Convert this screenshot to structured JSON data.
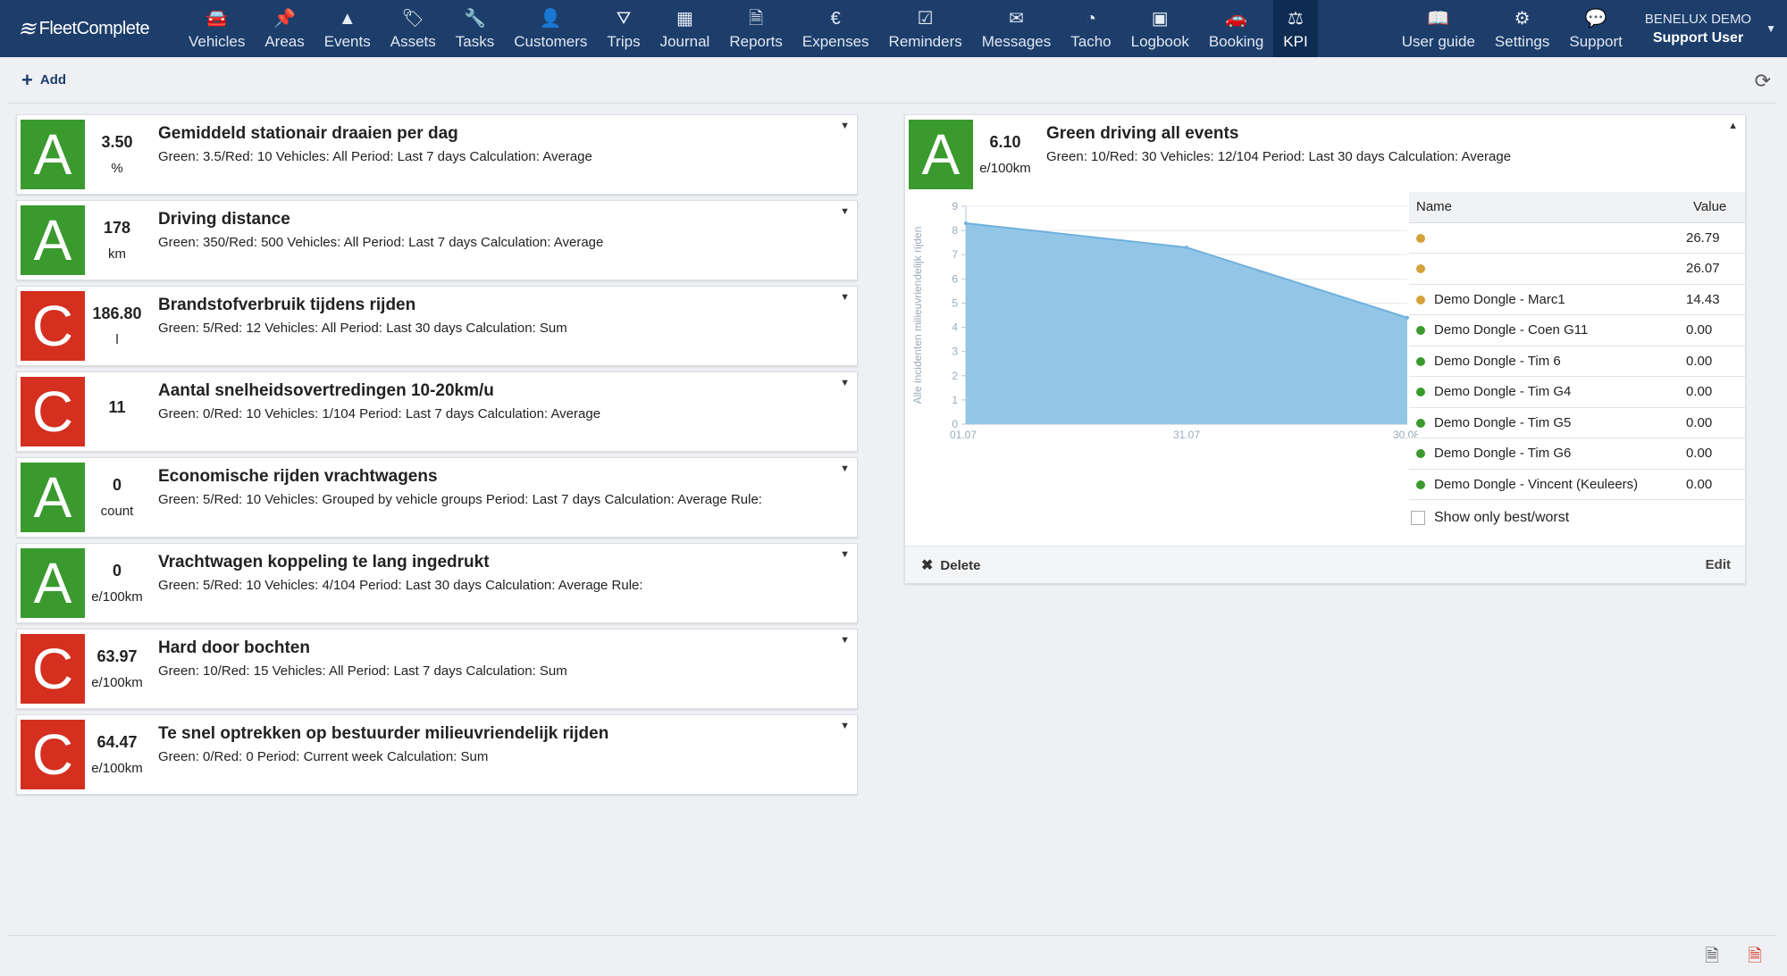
{
  "brand": {
    "name": "FleetComplete"
  },
  "nav": {
    "items": [
      {
        "label": "Vehicles",
        "icon": "car-icon"
      },
      {
        "label": "Areas",
        "icon": "pin-icon"
      },
      {
        "label": "Events",
        "icon": "warning-icon"
      },
      {
        "label": "Assets",
        "icon": "tag-icon"
      },
      {
        "label": "Tasks",
        "icon": "wrench-icon"
      },
      {
        "label": "Customers",
        "icon": "person-icon"
      },
      {
        "label": "Trips",
        "icon": "road-icon"
      },
      {
        "label": "Journal",
        "icon": "calendar-icon"
      },
      {
        "label": "Reports",
        "icon": "document-icon"
      },
      {
        "label": "Expenses",
        "icon": "euro-icon"
      },
      {
        "label": "Reminders",
        "icon": "calendar-check-icon"
      },
      {
        "label": "Messages",
        "icon": "envelope-icon"
      },
      {
        "label": "Tacho",
        "icon": "dashboard-icon"
      },
      {
        "label": "Logbook",
        "icon": "briefcase-icon"
      },
      {
        "label": "Booking",
        "icon": "car-front-icon"
      },
      {
        "label": "KPI",
        "icon": "balance-icon"
      }
    ],
    "active": "KPI",
    "right_items": [
      {
        "label": "User guide",
        "icon": "book-icon"
      },
      {
        "label": "Settings",
        "icon": "gears-icon"
      },
      {
        "label": "Support",
        "icon": "chat-icon"
      }
    ],
    "account": {
      "org": "BENELUX DEMO",
      "user": "Support User"
    }
  },
  "toolbar": {
    "add_label": "Add"
  },
  "kpis": [
    {
      "grade": "A",
      "value": "3.50",
      "unit": "%",
      "title": "Gemiddeld stationair draaien per dag",
      "desc": "Green: 3.5/Red: 10 Vehicles: All Period: Last 7 days Calculation: Average"
    },
    {
      "grade": "A",
      "value": "178",
      "unit": "km",
      "title": "Driving distance",
      "desc": "Green: 350/Red: 500 Vehicles: All Period: Last 7 days Calculation: Average"
    },
    {
      "grade": "C",
      "value": "186.80",
      "unit": "l",
      "title": "Brandstofverbruik tijdens rijden",
      "desc": "Green: 5/Red: 12 Vehicles: All Period: Last 30 days Calculation: Sum"
    },
    {
      "grade": "C",
      "value": "11",
      "unit": "",
      "title": "Aantal snelheidsovertredingen 10-20km/u",
      "desc": "Green: 0/Red: 10 Vehicles: 1/104 Period: Last 7 days Calculation: Average"
    },
    {
      "grade": "A",
      "value": "0",
      "unit": "count",
      "title": "Economische rijden vrachtwagens",
      "desc": "Green: 5/Red: 10 Vehicles: Grouped by vehicle groups Period: Last 7 days Calculation: Average Rule:"
    },
    {
      "grade": "A",
      "value": "0",
      "unit": "e/100km",
      "title": "Vrachtwagen koppeling te lang ingedrukt",
      "desc": "Green: 5/Red: 10 Vehicles: 4/104 Period: Last 30 days Calculation: Average Rule:"
    },
    {
      "grade": "C",
      "value": "63.97",
      "unit": "e/100km",
      "title": "Hard door bochten",
      "desc": "Green: 10/Red: 15 Vehicles: All Period: Last 7 days Calculation: Sum"
    },
    {
      "grade": "C",
      "value": "64.47",
      "unit": "e/100km",
      "title": "Te snel optrekken op bestuurder milieuvriendelijk rijden",
      "desc": "Green: 0/Red: 0 Period: Current week Calculation: Sum"
    }
  ],
  "detail": {
    "grade": "A",
    "value": "6.10",
    "unit": "e/100km",
    "title": "Green driving all events",
    "desc": "Green: 10/Red: 30 Vehicles: 12/104 Period: Last 30 days Calculation: Average",
    "table": {
      "headers": [
        "Name",
        "Value"
      ],
      "rows": [
        {
          "name": "",
          "value": "26.79",
          "status": "#d4a13a"
        },
        {
          "name": "",
          "value": "26.07",
          "status": "#d4a13a"
        },
        {
          "name": "Demo Dongle - Marc1",
          "value": "14.43",
          "status": "#d4a13a"
        },
        {
          "name": "Demo Dongle - Coen G11",
          "value": "0.00",
          "status": "#3a9a2e"
        },
        {
          "name": "Demo Dongle - Tim 6",
          "value": "0.00",
          "status": "#3a9a2e"
        },
        {
          "name": "Demo Dongle - Tim G4",
          "value": "0.00",
          "status": "#3a9a2e"
        },
        {
          "name": "Demo Dongle - Tim G5",
          "value": "0.00",
          "status": "#3a9a2e"
        },
        {
          "name": "Demo Dongle - Tim G6",
          "value": "0.00",
          "status": "#3a9a2e"
        },
        {
          "name": "Demo Dongle - Vincent (Keuleers)",
          "value": "0.00",
          "status": "#3a9a2e"
        }
      ]
    },
    "show_only_label": "Show only best/worst",
    "delete_label": "Delete",
    "edit_label": "Edit"
  },
  "chart_data": {
    "type": "area",
    "x": [
      "01.07",
      "31.07",
      "30.08"
    ],
    "values": [
      8.3,
      7.3,
      4.4
    ],
    "ylabel": "Alle incidenten milieuvriendelijk rijden",
    "ylim": [
      0,
      9
    ],
    "yticks": [
      0,
      1,
      2,
      3,
      4,
      5,
      6,
      7,
      8,
      9
    ],
    "grid": true,
    "color": "#93c6e6"
  }
}
